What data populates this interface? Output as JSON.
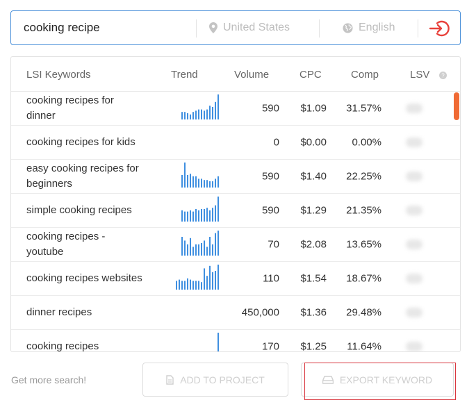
{
  "search": {
    "query": "cooking recipe",
    "location": "United States",
    "language": "English"
  },
  "table": {
    "headers": {
      "keyword": "LSI Keywords",
      "trend": "Trend",
      "volume": "Volume",
      "cpc": "CPC",
      "comp": "Comp",
      "lsv": "LSV"
    },
    "rows": [
      {
        "keyword": "cooking recipes for dinner",
        "trend": [
          0.3,
          0.3,
          0.25,
          0.2,
          0.3,
          0.35,
          0.4,
          0.4,
          0.35,
          0.4,
          0.55,
          0.5,
          0.7,
          1.0
        ],
        "volume": "590",
        "cpc": "$1.09",
        "comp": "31.57%"
      },
      {
        "keyword": "cooking recipes for kids",
        "trend": [],
        "volume": "0",
        "cpc": "$0.00",
        "comp": "0.00%"
      },
      {
        "keyword": "easy cooking recipes for beginners",
        "trend": [
          0.5,
          1.0,
          0.5,
          0.55,
          0.45,
          0.45,
          0.35,
          0.35,
          0.3,
          0.3,
          0.25,
          0.25,
          0.35,
          0.45
        ],
        "volume": "590",
        "cpc": "$1.40",
        "comp": "22.25%"
      },
      {
        "keyword": "simple cooking recipes",
        "trend": [
          0.45,
          0.4,
          0.4,
          0.45,
          0.4,
          0.5,
          0.45,
          0.5,
          0.5,
          0.55,
          0.45,
          0.55,
          0.65,
          1.0
        ],
        "volume": "590",
        "cpc": "$1.29",
        "comp": "21.35%"
      },
      {
        "keyword": "cooking recipes - youtube",
        "trend": [
          0.75,
          0.6,
          0.45,
          0.7,
          0.35,
          0.45,
          0.45,
          0.5,
          0.6,
          0.35,
          0.75,
          0.45,
          0.9,
          1.0
        ],
        "volume": "70",
        "cpc": "$2.08",
        "comp": "13.65%"
      },
      {
        "keyword": "cooking recipes websites",
        "trend": [
          0.35,
          0.4,
          0.35,
          0.35,
          0.45,
          0.4,
          0.35,
          0.35,
          0.35,
          0.3,
          0.85,
          0.55,
          0.95,
          0.7,
          0.75,
          1.0
        ],
        "volume": "110",
        "cpc": "$1.54",
        "comp": "18.67%"
      },
      {
        "keyword": "dinner recipes",
        "trend": [],
        "volume": "450,000",
        "cpc": "$1.36",
        "comp": "29.48%"
      },
      {
        "keyword": "cooking recipes",
        "trend": [
          1.0
        ],
        "volume": "170",
        "cpc": "$1.25",
        "comp": "11.64%"
      }
    ]
  },
  "footer": {
    "more_search": "Get more search!",
    "add_label": "ADD TO PROJECT",
    "export_label": "EXPORT KEYWORD"
  },
  "colors": {
    "accent_blue": "#4a90d9",
    "trend_blue": "#3f8fe0",
    "brand_orange": "#f06a34",
    "go_red": "#e8413b"
  }
}
